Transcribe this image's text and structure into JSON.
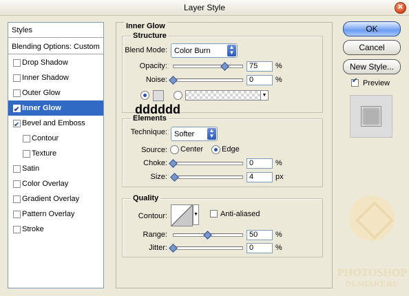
{
  "window": {
    "title": "Layer Style"
  },
  "sidebar": {
    "styles_label": "Styles",
    "blending_label": "Blending Options: Custom",
    "items": [
      {
        "label": "Drop Shadow",
        "checked": false
      },
      {
        "label": "Inner Shadow",
        "checked": false
      },
      {
        "label": "Outer Glow",
        "checked": false
      },
      {
        "label": "Inner Glow",
        "checked": true,
        "selected": true
      },
      {
        "label": "Bevel and Emboss",
        "checked": true
      },
      {
        "label": "Contour",
        "checked": false
      },
      {
        "label": "Texture",
        "checked": false
      },
      {
        "label": "Satin",
        "checked": false
      },
      {
        "label": "Color Overlay",
        "checked": false
      },
      {
        "label": "Gradient Overlay",
        "checked": false
      },
      {
        "label": "Pattern Overlay",
        "checked": false
      },
      {
        "label": "Stroke",
        "checked": false
      }
    ]
  },
  "panel": {
    "title": "Inner Glow",
    "structure": {
      "title": "Structure",
      "blend_mode_label": "Blend Mode:",
      "blend_mode_value": "Color Burn",
      "opacity_label": "Opacity:",
      "opacity_value": "75",
      "opacity_unit": "%",
      "opacity_level": 0.75,
      "noise_label": "Noise:",
      "noise_value": "0",
      "noise_unit": "%",
      "noise_level": 0,
      "color_hex_note": "dddddd",
      "glow_color": "#dddddd"
    },
    "elements": {
      "title": "Elements",
      "technique_label": "Technique:",
      "technique_value": "Softer",
      "source_label": "Source:",
      "source_center": "Center",
      "source_edge": "Edge",
      "choke_label": "Choke:",
      "choke_value": "0",
      "choke_unit": "%",
      "choke_level": 0,
      "size_label": "Size:",
      "size_value": "4",
      "size_unit": "px",
      "size_level": 0.02
    },
    "quality": {
      "title": "Quality",
      "contour_label": "Contour:",
      "anti_aliased_label": "Anti-aliased",
      "range_label": "Range:",
      "range_value": "50",
      "range_unit": "%",
      "range_level": 0.5,
      "jitter_label": "Jitter:",
      "jitter_value": "0",
      "jitter_unit": "%",
      "jitter_level": 0
    }
  },
  "buttons": {
    "ok": "OK",
    "cancel": "Cancel",
    "new_style": "New Style...",
    "preview": "Preview"
  },
  "watermark": {
    "line1": "PHOTOSHOP",
    "line2": "DEMIART.RU"
  }
}
